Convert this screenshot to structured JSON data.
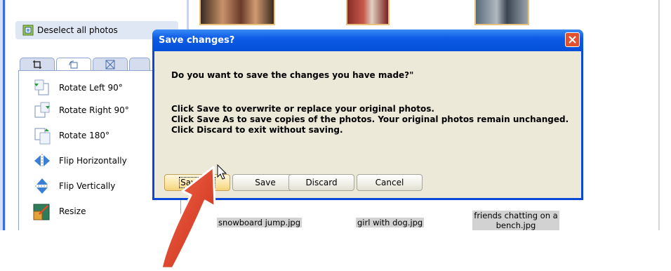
{
  "panel": {
    "deselect_label": "Deselect all photos",
    "tools": [
      {
        "label": "Rotate Left 90°",
        "icon": "rotate-left-icon"
      },
      {
        "label": "Rotate Right 90°",
        "icon": "rotate-right-icon"
      },
      {
        "label": "Rotate 180°",
        "icon": "rotate-180-icon"
      },
      {
        "label": "Flip Horizontally",
        "icon": "flip-horizontal-icon"
      },
      {
        "label": "Flip Vertically",
        "icon": "flip-vertical-icon"
      },
      {
        "label": "Resize",
        "icon": "resize-icon"
      }
    ]
  },
  "photos": [
    {
      "caption": "snowboard jump.jpg"
    },
    {
      "caption": "girl with dog.jpg"
    },
    {
      "caption": "friends chatting on a bench.jpg"
    }
  ],
  "dialog": {
    "title": "Save changes?",
    "question": "Do you want to save the changes you have made?\"",
    "line1": "Click Save to overwrite or replace your original photos.",
    "line2": "Click Save As to save copies of the photos. Your original photos remain unchanged.",
    "line3": "Click Discard to exit without saving.",
    "buttons": {
      "save_as": "Save As",
      "save": "Save",
      "discard": "Discard",
      "cancel": "Cancel"
    }
  },
  "colors": {
    "titlebar": "#0450d8",
    "dialog_body": "#ece9d8",
    "close_button": "#e2512d",
    "annotation_arrow": "#e8402a"
  }
}
